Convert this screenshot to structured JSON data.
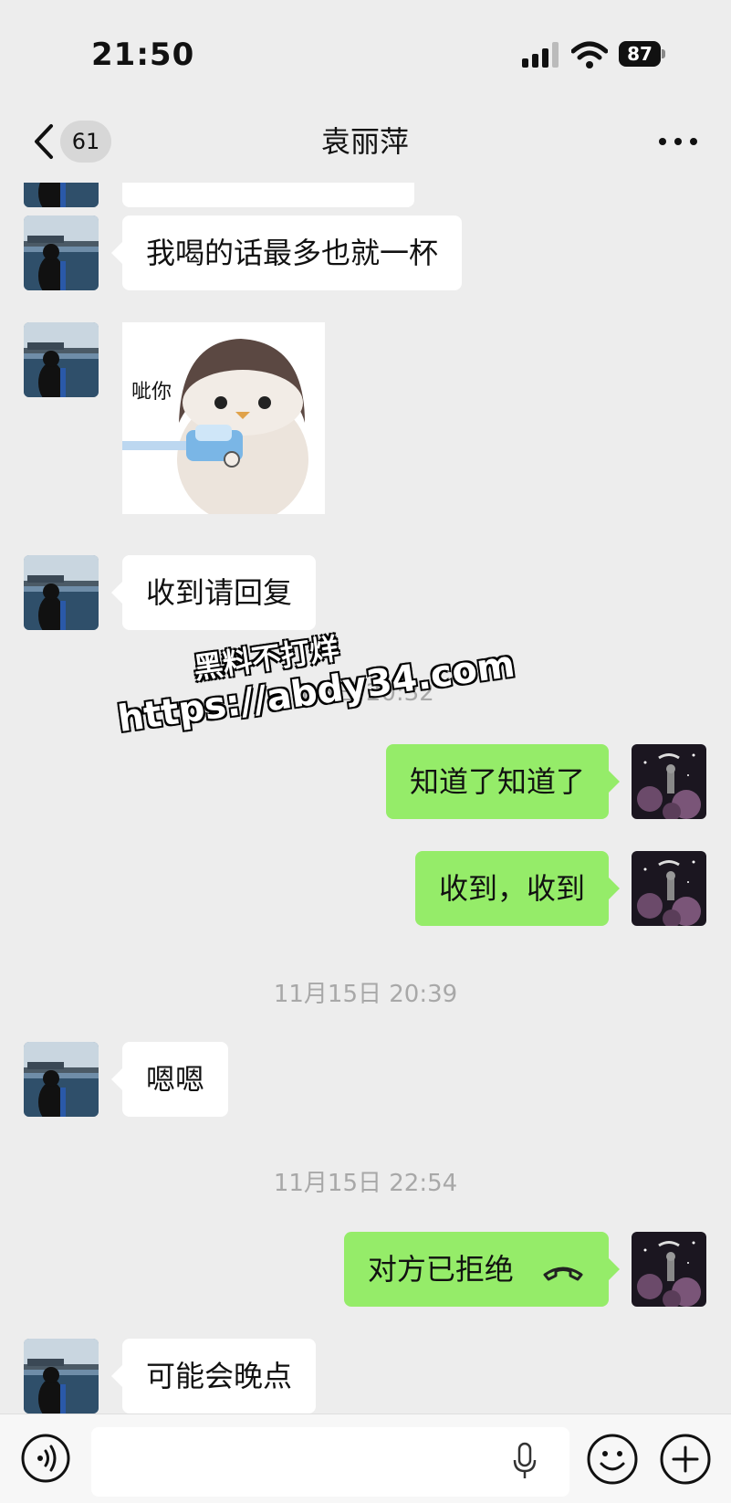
{
  "status_bar": {
    "time": "21:50",
    "battery": "87"
  },
  "nav": {
    "unread_count": "61",
    "title": "袁丽萍"
  },
  "messages": {
    "m1": "我喝的话最多也就一杯",
    "sticker_caption": "呲你",
    "m2": "收到请回复",
    "m3": "知道了知道了",
    "m4": "收到，收到",
    "t2": "11月15日 20:39",
    "m5": "嗯嗯",
    "t3": "11月15日 22:54",
    "m6": "对方已拒绝",
    "m7": "可能会晚点"
  },
  "watermark": {
    "line1": "黑料不打烊",
    "line2": "https://abdy34.com",
    "partial_timestamp": "1 5日 20:32"
  },
  "icons": {
    "back": "chevron-left-icon",
    "more": "more-dots-icon",
    "signal": "signal-icon",
    "wifi": "wifi-icon",
    "battery": "battery-icon",
    "voice": "voice-icon",
    "mic": "microphone-icon",
    "emoji": "emoji-icon",
    "plus": "plus-icon",
    "call": "phone-declined-icon"
  },
  "colors": {
    "background": "#ededed",
    "incoming_bubble": "#ffffff",
    "outgoing_bubble": "#95ec69",
    "timestamp": "#a8a8a8"
  }
}
